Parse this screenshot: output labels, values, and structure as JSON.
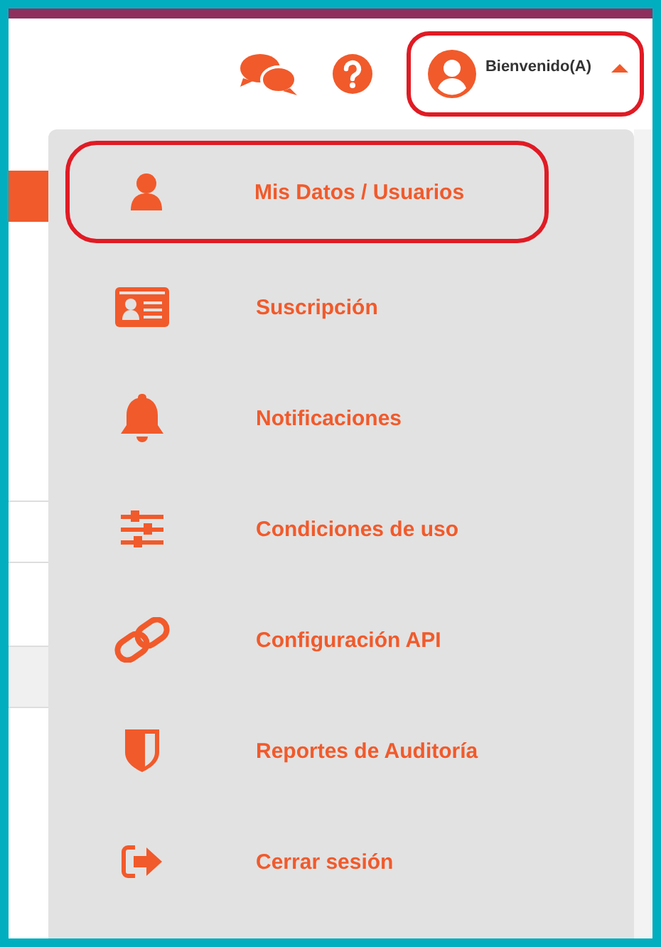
{
  "header": {
    "user_menu": {
      "greeting": "Bienvenido(A)",
      "expanded": true,
      "highlighted": true
    }
  },
  "dropdown": {
    "items": [
      {
        "kind": "user",
        "label": "Mis Datos / Usuarios",
        "highlighted": true
      },
      {
        "kind": "card",
        "label": "Suscripción",
        "highlighted": false
      },
      {
        "kind": "bell",
        "label": "Notificaciones",
        "highlighted": false
      },
      {
        "kind": "sliders",
        "label": "Condiciones de uso",
        "highlighted": false
      },
      {
        "kind": "link",
        "label": "Configuración API",
        "highlighted": false
      },
      {
        "kind": "shield",
        "label": "Reportes de Auditoría",
        "highlighted": false
      },
      {
        "kind": "logout",
        "label": "Cerrar sesión",
        "highlighted": false
      }
    ]
  }
}
